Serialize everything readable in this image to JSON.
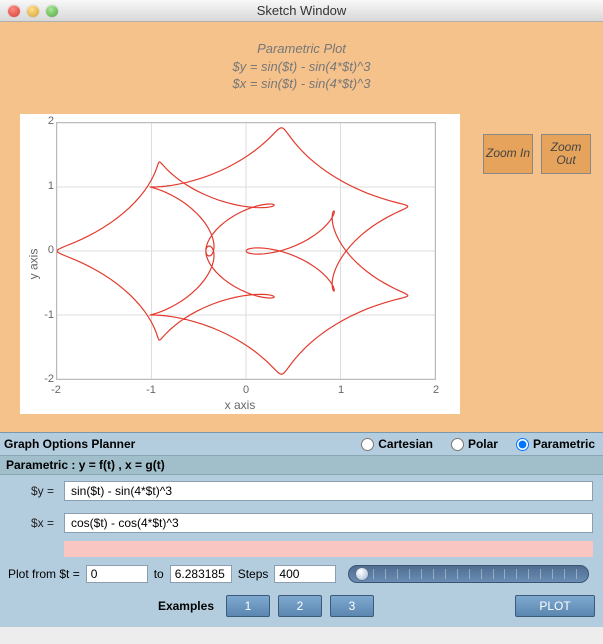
{
  "window": {
    "title": "Sketch Window"
  },
  "plot": {
    "title": "Parametric Plot",
    "eq_y_display": "$y = sin($t) - sin(4*$t)^3",
    "eq_x_display": "$x = sin($t) - sin(4*$t)^3",
    "xlabel": "x axis",
    "ylabel": "y axis"
  },
  "zoom": {
    "in": "Zoom\nIn",
    "out": "Zoom\nOut"
  },
  "options": {
    "panel_title": "Graph Options Planner",
    "modes": {
      "cartesian": "Cartesian",
      "polar": "Polar",
      "parametric": "Parametric"
    },
    "selected_mode": "parametric",
    "mode_desc": "Parametric : y = f(t) ,  x = g(t)",
    "y_label": "$y =",
    "x_label": "$x =",
    "y_value": "sin($t) - sin(4*$t)^3",
    "x_value": "cos($t) - cos(4*$t)^3",
    "range_label_pre": "Plot from $t =",
    "range_from": "0",
    "range_to_label": "to",
    "range_to": "6.283185",
    "steps_label": "Steps",
    "steps": "400",
    "examples_label": "Examples",
    "ex1": "1",
    "ex2": "2",
    "ex3": "3",
    "plot_btn": "PLOT"
  },
  "chart_data": {
    "type": "line",
    "title": "Parametric Plot",
    "xlabel": "x axis",
    "ylabel": "y axis",
    "xlim": [
      -2,
      2
    ],
    "ylim": [
      -2,
      2
    ],
    "xticks": [
      -2,
      -1,
      0,
      1,
      2
    ],
    "yticks": [
      -2,
      -1,
      0,
      1,
      2
    ],
    "grid": true,
    "parametric": {
      "t_from": 0,
      "t_to": 6.283185,
      "steps": 400,
      "x_of_t": "cos(t) - cos(4*t)^3",
      "y_of_t": "sin(t) - sin(4*t)^3"
    }
  }
}
